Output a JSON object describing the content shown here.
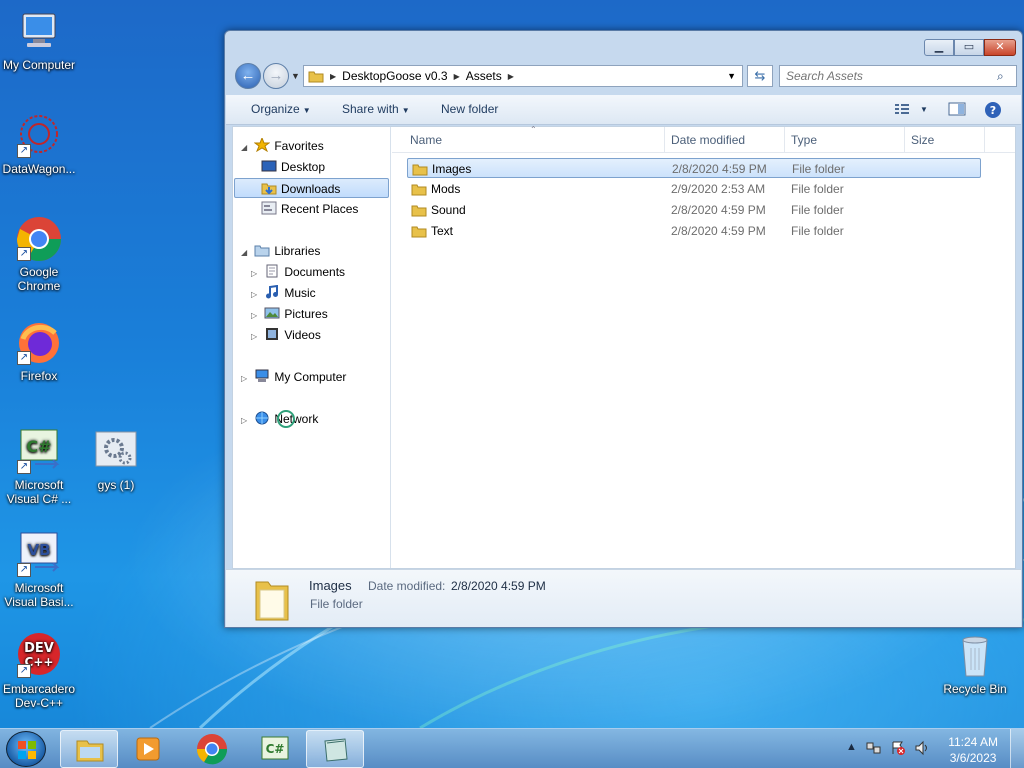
{
  "desktop": {
    "icons": [
      {
        "label": "My Computer"
      },
      {
        "label": "DataWagon..."
      },
      {
        "label": "Google Chrome"
      },
      {
        "label": "Firefox"
      },
      {
        "label": "Microsoft Visual C# ..."
      },
      {
        "label": "gys (1)"
      },
      {
        "label": "Microsoft Visual Basi..."
      },
      {
        "label": "Embarcadero Dev-C++"
      },
      {
        "label": "Recycle Bin"
      }
    ]
  },
  "explorer": {
    "breadcrumb": [
      "DesktopGoose v0.3",
      "Assets"
    ],
    "search_placeholder": "Search Assets",
    "toolbar": {
      "organize": "Organize",
      "share_with": "Share with",
      "new_folder": "New folder"
    },
    "nav": {
      "favorites": "Favorites",
      "desktop": "Desktop",
      "downloads": "Downloads",
      "recent_places": "Recent Places",
      "libraries": "Libraries",
      "documents": "Documents",
      "music": "Music",
      "pictures": "Pictures",
      "videos": "Videos",
      "my_computer": "My Computer",
      "network": "Network"
    },
    "columns": {
      "name": "Name",
      "date_modified": "Date modified",
      "type": "Type",
      "size": "Size"
    },
    "files": [
      {
        "name": "Images",
        "date": "2/8/2020 4:59 PM",
        "type": "File folder"
      },
      {
        "name": "Mods",
        "date": "2/9/2020 2:53 AM",
        "type": "File folder"
      },
      {
        "name": "Sound",
        "date": "2/8/2020 4:59 PM",
        "type": "File folder"
      },
      {
        "name": "Text",
        "date": "2/8/2020 4:59 PM",
        "type": "File folder"
      }
    ],
    "details": {
      "name": "Images",
      "date_label": "Date modified:",
      "date_value": "2/8/2020 4:59 PM",
      "type": "File folder"
    }
  },
  "taskbar": {
    "apps": [
      "explorer-icon",
      "media-player-icon",
      "chrome-icon",
      "visual-csharp-icon",
      "window-icon"
    ],
    "clock_time": "11:24 AM",
    "clock_date": "3/6/2023"
  },
  "colors": {
    "accent": "#1a7fd9",
    "selection": "#cce2fb"
  }
}
